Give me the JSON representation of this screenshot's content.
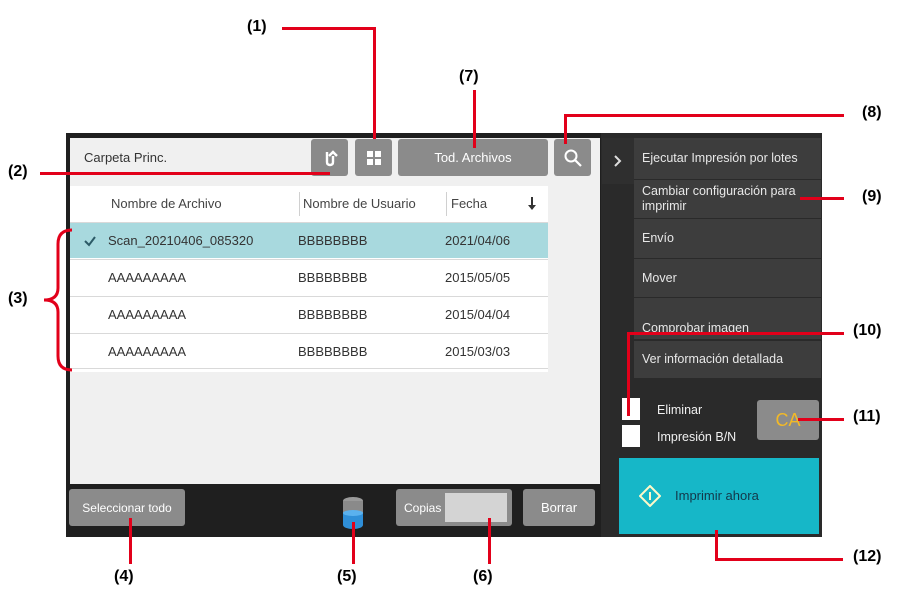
{
  "toolbar": {
    "path_label": "Carpeta Princ.",
    "all_files_label": "Tod. Archivos"
  },
  "table": {
    "headers": [
      "Nombre de Archivo",
      "Nombre de Usuario",
      "Fecha"
    ],
    "rows": [
      {
        "name": "Scan_20210406_085320",
        "user": "BBBBBBBB",
        "date": "2021/04/06",
        "selected": true
      },
      {
        "name": "AAAAAAAAA",
        "user": "BBBBBBBB",
        "date": "2015/05/05",
        "selected": false
      },
      {
        "name": "AAAAAAAAA",
        "user": "BBBBBBBB",
        "date": "2015/04/04",
        "selected": false
      },
      {
        "name": "AAAAAAAAA",
        "user": "BBBBBBBB",
        "date": "2015/03/03",
        "selected": false
      }
    ]
  },
  "bottom": {
    "select_all_label": "Seleccionar todo",
    "copies_label": "Copias",
    "delete_label": "Borrar"
  },
  "sidebar": {
    "menu": [
      "Ejecutar Impresión por lotes",
      "Cambiar configuración para imprimir",
      "Envío",
      "Mover",
      "Comprobar imagen",
      "Ver información detallada"
    ],
    "eliminar_label": "Eliminar",
    "bn_label": "Impresión B/N",
    "ca_label": "CA",
    "print_now_label": "Imprimir ahora"
  },
  "callouts": [
    "(1)",
    "(2)",
    "(3)",
    "(4)",
    "(5)",
    "(6)",
    "(7)",
    "(8)",
    "(9)",
    "(10)",
    "(11)",
    "(12)"
  ],
  "colors": {
    "accent_callout": "#e2001a",
    "selected_row": "#a8d9de",
    "print_button": "#16b7c8",
    "ca_text": "#f2b927"
  }
}
